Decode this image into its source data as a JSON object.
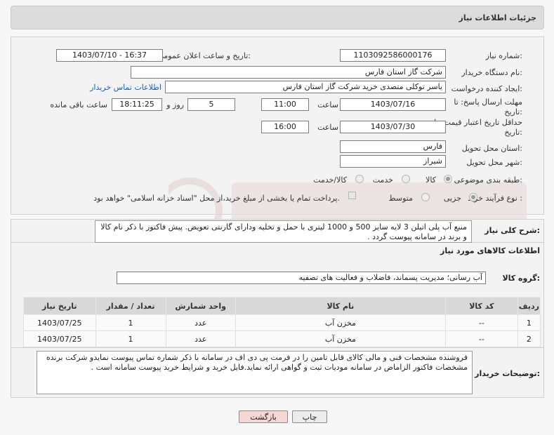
{
  "header": {
    "title": "جزئیات اطلاعات نیاز"
  },
  "form": {
    "need_number_label": "شماره نیاز:",
    "need_number": "1103092586000176",
    "announce_label": "تاریخ و ساعت اعلان عمومی:",
    "announce_value": "1403/07/10 - 16:37",
    "buyer_org_label": "نام دستگاه خریدار:",
    "buyer_org": "شرکت گاز استان فارس",
    "requester_label": "ایجاد کننده درخواست:",
    "requester": "یاسر توکلی متصدی خرید شرکت گاز استان فارس",
    "buyer_contact_link": "اطلاعات تماس خریدار",
    "deadline_label": "مهلت ارسال پاسخ: تا تاریخ:",
    "deadline_date": "1403/07/16",
    "time_label": "ساعت",
    "deadline_time": "11:00",
    "days_value": "5",
    "days_label": "روز و",
    "remaining_time": "18:11:25",
    "remaining_label": "ساعت باقی مانده",
    "validity_label": "حداقل تاریخ اعتبار قیمت: تا تاریخ:",
    "validity_date": "1403/07/30",
    "validity_time": "16:00",
    "province_label": "استان محل تحویل:",
    "province": "فارس",
    "city_label": "شهر محل تحویل:",
    "city": "شیراز",
    "category_label": "طبقه بندی موضوعی:",
    "category_options": [
      "کالا",
      "خدمت",
      "کالا/خدمت"
    ],
    "process_label": "نوع فرآیند خرید :",
    "process_options": [
      "جزیی",
      "متوسط"
    ],
    "payment_note": "پرداخت تمام یا بخشی از مبلغ خرید،از محل \"اسناد خزانه اسلامی\" خواهد بود."
  },
  "description": {
    "label": "شرح کلی نیاز:",
    "text": "منبع آب پلی اتیلن 3 لایه سایز 500 و 1000 لیتری با حمل و تخلیه ودارای گارنتی تعویض. پیش فاکتور با ذکر نام کالا و برند در سامانه پیوست گردد ."
  },
  "goods": {
    "section_title": "اطلاعات کالاهای مورد نیاز",
    "group_label": "گروه کالا:",
    "group_value": "آب رسانی؛ مدیریت پسماند، فاضلاب و فعالیت های تصفیه",
    "columns": [
      "ردیف",
      "کد کالا",
      "نام کالا",
      "واحد شمارش",
      "تعداد / مقدار",
      "تاریخ نیاز"
    ],
    "rows": [
      {
        "row": "1",
        "code": "--",
        "name": "مخزن آب",
        "unit": "عدد",
        "qty": "1",
        "date": "1403/07/25"
      },
      {
        "row": "2",
        "code": "--",
        "name": "مخزن آب",
        "unit": "عدد",
        "qty": "1",
        "date": "1403/07/25"
      }
    ]
  },
  "buyer_notes": {
    "label": "توضیحات خریدار:",
    "text": "فروشنده مشخصات فنی و مالی کالای قابل تامین را در فرمت پی دی اف در سامانه با ذکر شماره تماس پیوست نمایدو شرکت برنده مشخصات فاکتور الزاماض در سامانه مودیات ثبت و گواهی ارائه نماید.فایل خرید و شرایط خرید پیوست سامانه است ."
  },
  "buttons": {
    "print": "چاپ",
    "back": "بازگشت"
  },
  "colors": {
    "back_button_bg": "#f7d6d6",
    "print_button_bg": "#ececec",
    "link": "#1a5fb4",
    "table_header": "#d8d8d8"
  }
}
